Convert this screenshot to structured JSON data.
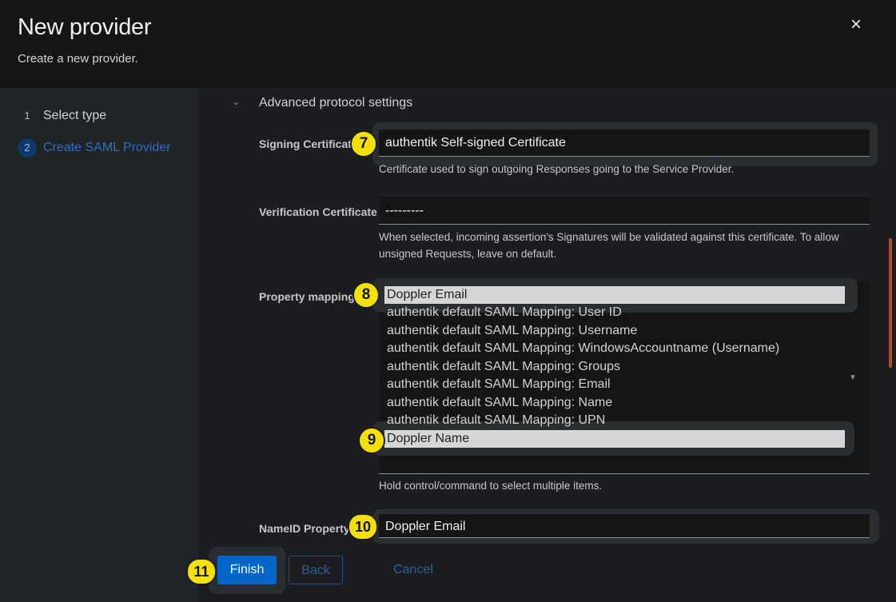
{
  "dialog": {
    "title": "New provider",
    "subtitle": "Create a new provider.",
    "close_icon": "×"
  },
  "wizard": {
    "steps": [
      {
        "number": "1",
        "label": "Select type"
      },
      {
        "number": "2",
        "label": "Create SAML Provider"
      }
    ]
  },
  "form": {
    "advanced_section": "Advanced protocol settings",
    "signing_certificate": {
      "label": "Signing Certificate",
      "value": "authentik Self-signed Certificate",
      "helper": "Certificate used to sign outgoing Responses going to the Service Provider."
    },
    "verification_certificate": {
      "label": "Verification Certificate",
      "value": "---------",
      "helper": "When selected, incoming assertion's Signatures will be validated against this certificate. To allow unsigned Requests, leave on default."
    },
    "property_mappings": {
      "label": "Property mappings",
      "options": [
        "Doppler Email",
        "authentik default SAML Mapping: User ID",
        "authentik default SAML Mapping: Username",
        "authentik default SAML Mapping: WindowsAccountname (Username)",
        "authentik default SAML Mapping: Groups",
        "authentik default SAML Mapping: Email",
        "authentik default SAML Mapping: Name",
        "authentik default SAML Mapping: UPN",
        "Doppler Name"
      ],
      "selected": [
        "Doppler Email",
        "Doppler Name"
      ],
      "helper": "Hold control/command to select multiple items."
    },
    "nameid_property": {
      "label": "NameID Property",
      "value": "Doppler Email"
    }
  },
  "footer": {
    "finish": "Finish",
    "back": "Back",
    "cancel": "Cancel"
  },
  "callouts": [
    "7",
    "8",
    "9",
    "10",
    "11"
  ],
  "colors": {
    "accent": "#0066cc",
    "callout": "#f5e100",
    "scroll_indicator": "#b54a33"
  }
}
